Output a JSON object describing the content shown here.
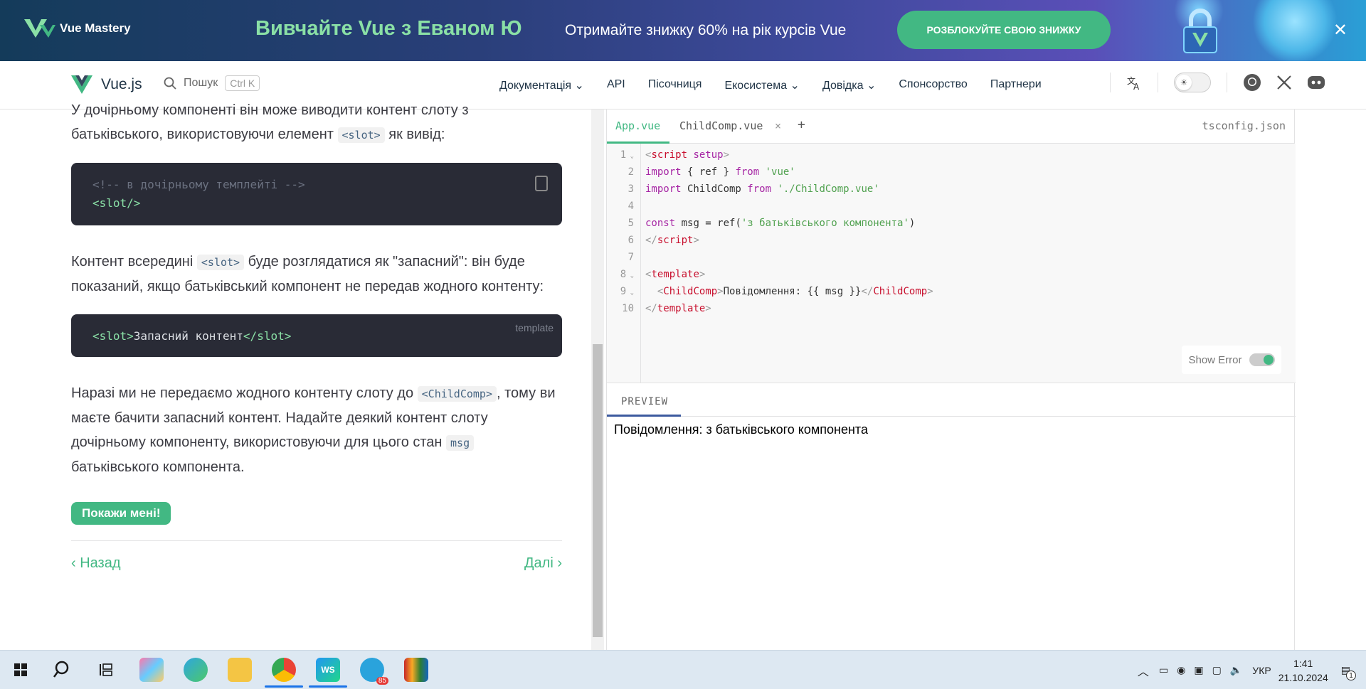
{
  "banner": {
    "brand": "Vue Mastery",
    "headline": "Вивчайте Vue з Еваном Ю",
    "subtext": "Отримайте знижку 60% на рік курсів Vue",
    "cta": "РОЗБЛОКУЙТЕ СВОЮ ЗНИЖКУ",
    "close": "✕"
  },
  "nav": {
    "brand": "Vue.js",
    "search_label": "Пошук",
    "search_shortcut": "Ctrl K",
    "menu": [
      "Документація ⌄",
      "API",
      "Пісочниця",
      "Екосистема ⌄",
      "Довідка ⌄",
      "Спонсорство",
      "Партнери"
    ]
  },
  "content": {
    "para1_a": "У дочірньому компоненті він може виводити контент слоту з батьківського, використовуючи елемент ",
    "para1_code": "<slot>",
    "para1_b": " як вивід:",
    "code1_comment": "<!-- в дочірньому темплейті -->",
    "code1_line": "<slot/>",
    "para2_a": "Контент всередині ",
    "para2_code": "<slot>",
    "para2_b": " буде розглядатися як \"запасний\": він буде показаний, якщо батьківський компонент не передав жодного контенту:",
    "code2_lang": "template",
    "code2_open": "<slot>",
    "code2_text": "Запасний контент",
    "code2_close": "</slot>",
    "para3_a": "Наразі ми не передаємо жодного контенту слоту до ",
    "para3_code": "<ChildComp>",
    "para3_b": ", тому ви маєте бачити запасний контент. Надайте деякий контент слоту дочірньому компоненту, використовуючи для цього стан ",
    "para3_code2": "msg",
    "para3_c": " батьківського компонента.",
    "show_btn": "Покажи мені!",
    "prev": "Назад",
    "next": "Далі"
  },
  "editor": {
    "tabs": [
      "App.vue",
      "ChildComp.vue"
    ],
    "tab_close": "×",
    "add_tab": "+",
    "tsconfig": "tsconfig.json",
    "show_error": "Show Error",
    "show_error_on": true,
    "preview_tab": "PREVIEW",
    "preview_output": "Повідомлення: з батьківського компонента"
  },
  "taskbar": {
    "lang": "УКР",
    "time": "1:41",
    "date": "21.10.2024",
    "telegram_badge": "85",
    "notif_badge": "1"
  },
  "colors": {
    "accent": "#42b883",
    "dark_code_bg": "#292b36"
  }
}
